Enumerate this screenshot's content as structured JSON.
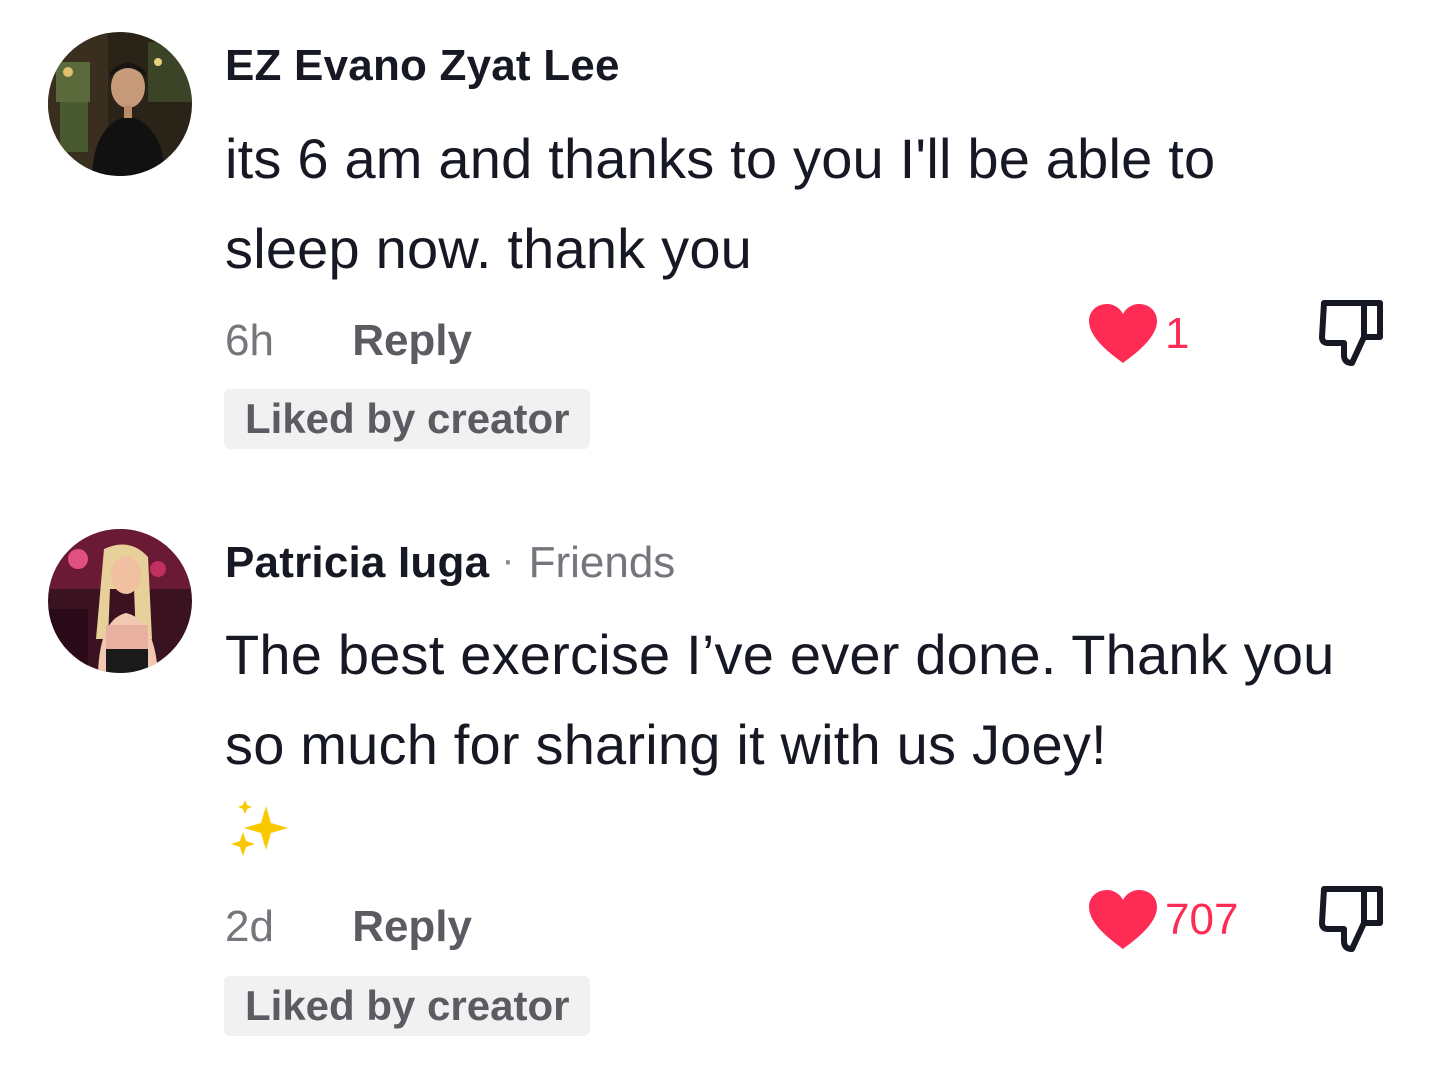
{
  "comments": [
    {
      "username": "EZ Evano Zyat Lee",
      "relation": "",
      "text": "its 6 am and thanks to you I'll be able to sleep now. thank you",
      "emoji": "",
      "timestamp": "6h",
      "reply_label": "Reply",
      "like_count": "1",
      "badge": "Liked by creator"
    },
    {
      "username": "Patricia Iuga",
      "separator": "·",
      "relation": "Friends",
      "text": "The best exercise I’ve ever done. Thank you so much for sharing it with us Joey!",
      "emoji": "sparkles-emoji",
      "timestamp": "2d",
      "reply_label": "Reply",
      "like_count": "707",
      "badge": "Liked by creator"
    }
  ],
  "colors": {
    "like_red": "#fe2c55",
    "text_primary": "#161823",
    "text_secondary": "#75767c",
    "badge_bg": "#f1f1f2"
  },
  "icons": [
    "heart-icon",
    "thumbs-down-icon",
    "sparkles-emoji"
  ]
}
